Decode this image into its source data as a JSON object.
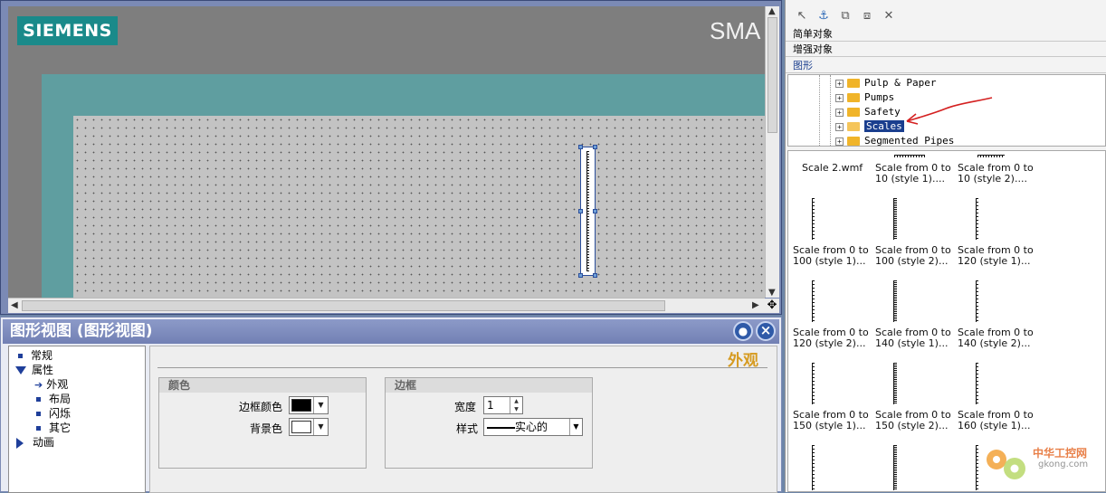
{
  "canvas": {
    "logo_text": "SIEMENS",
    "top_right_text": "SMA"
  },
  "properties_panel": {
    "title": "图形视图 (图形视图)",
    "pin_icon": "pin-icon",
    "close_icon": "close-icon",
    "nav": {
      "items": [
        {
          "label": "常规"
        },
        {
          "label": "属性"
        },
        {
          "label": "外观"
        },
        {
          "label": "布局"
        },
        {
          "label": "闪烁"
        },
        {
          "label": "其它"
        },
        {
          "label": "动画"
        }
      ]
    },
    "section_title": "外观",
    "color_group": {
      "title": "颜色",
      "border_color_label": "边框颜色",
      "border_color_value": "#000000",
      "bg_color_label": "背景色",
      "bg_color_value": "#ffffff"
    },
    "border_group": {
      "title": "边框",
      "width_label": "宽度",
      "width_value": "1",
      "style_label": "样式",
      "style_value": "实心的"
    }
  },
  "library": {
    "categories": [
      {
        "label": "简单对象"
      },
      {
        "label": "增强对象"
      },
      {
        "label": "图形"
      }
    ],
    "tree": [
      {
        "label": "Pulp & Paper"
      },
      {
        "label": "Pumps"
      },
      {
        "label": "Safety"
      },
      {
        "label": "Scales",
        "selected": true
      },
      {
        "label": "Segmented Pipes"
      }
    ],
    "items": [
      {
        "line1": "Scale 2.wmf",
        "line2": ""
      },
      {
        "line1": "Scale from 0 to",
        "line2": "10 (style 1)...."
      },
      {
        "line1": "Scale from 0 to",
        "line2": "10 (style 2)...."
      },
      {
        "line1": "Scale from 0 to",
        "line2": "100 (style 1)..."
      },
      {
        "line1": "Scale from 0 to",
        "line2": "100 (style 2)..."
      },
      {
        "line1": "Scale from 0 to",
        "line2": "120 (style 1)..."
      },
      {
        "line1": "Scale from 0 to",
        "line2": "120 (style 2)..."
      },
      {
        "line1": "Scale from 0 to",
        "line2": "140 (style 1)..."
      },
      {
        "line1": "Scale from 0 to",
        "line2": "140 (style 2)..."
      },
      {
        "line1": "Scale from 0 to",
        "line2": "150 (style 1)..."
      },
      {
        "line1": "Scale from 0 to",
        "line2": "150 (style 2)..."
      },
      {
        "line1": "Scale from 0 to",
        "line2": "160 (style 1)..."
      }
    ]
  },
  "watermark": {
    "text1": "中华工控网",
    "text2": "gkong.com"
  }
}
